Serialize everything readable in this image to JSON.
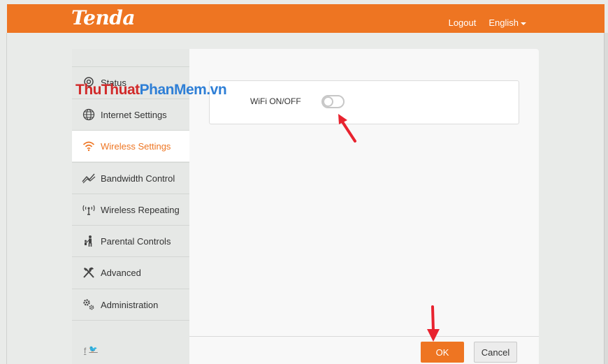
{
  "header": {
    "logo": "Tenda",
    "logout": "Logout",
    "language": "English",
    "accent": "#ee7522"
  },
  "sidebar": {
    "items": [
      {
        "label": "Status",
        "icon": "status-icon"
      },
      {
        "label": "Internet Settings",
        "icon": "globe-icon"
      },
      {
        "label": "Wireless Settings",
        "icon": "wifi-icon",
        "active": true
      },
      {
        "label": "Bandwidth Control",
        "icon": "chart-line-icon"
      },
      {
        "label": "Wireless Repeating",
        "icon": "repeater-icon"
      },
      {
        "label": "Parental Controls",
        "icon": "family-icon"
      },
      {
        "label": "Advanced",
        "icon": "tools-icon"
      },
      {
        "label": "Administration",
        "icon": "gears-icon"
      }
    ],
    "footer": {
      "facebook": "f",
      "twitter": "🐦"
    }
  },
  "watermark": {
    "part1": "ThuThuat",
    "part2": "PhanMem.vn"
  },
  "main": {
    "wifi_label": "WiFi ON/OFF",
    "wifi_enabled": false
  },
  "actions": {
    "ok": "OK",
    "cancel": "Cancel"
  }
}
